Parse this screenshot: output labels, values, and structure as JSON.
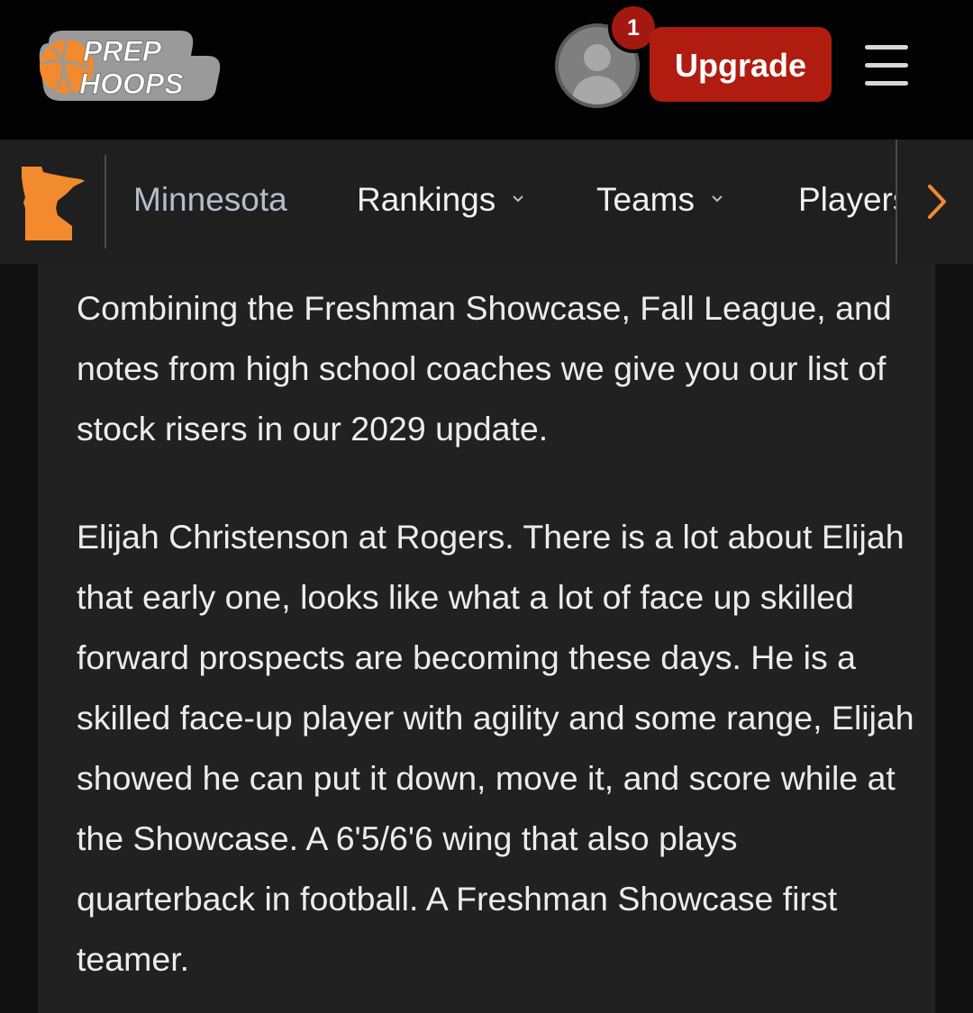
{
  "header": {
    "logo_line1": "PREP",
    "logo_line2": "HOOPS",
    "notification_count": "1",
    "upgrade_label": "Upgrade",
    "avatar_icon": "default-user-avatar",
    "menu_icon": "hamburger-menu-icon"
  },
  "nav": {
    "state_icon": "minnesota-state-icon",
    "state_label": "Minnesota",
    "items": [
      {
        "label": "Rankings",
        "has_dropdown": true
      },
      {
        "label": "Teams",
        "has_dropdown": true
      },
      {
        "label": "Players",
        "has_dropdown": false
      }
    ],
    "next_icon": "chevron-right-icon"
  },
  "article": {
    "paragraphs": [
      "Combining the Freshman Showcase, Fall League, and notes from high school coaches we give you our list of stock risers in our 2029 update.",
      "Elijah Christenson at Rogers. There is a lot about Elijah that early one, looks like what a lot of face up skilled forward prospects are becoming these days. He is a skilled face-up player with agility and some range, Elijah showed he can put it down, move it, and score while at the Showcase. A 6'5/6'6 wing that also plays quarterback in football. A Freshman Showcase first teamer."
    ]
  },
  "colors": {
    "accent_orange": "#f28a2e",
    "upgrade_red": "#b01d10",
    "badge_red": "#a31810",
    "header_bg": "#020202",
    "nav_bg": "#1f1f1f",
    "card_bg": "#212121"
  }
}
